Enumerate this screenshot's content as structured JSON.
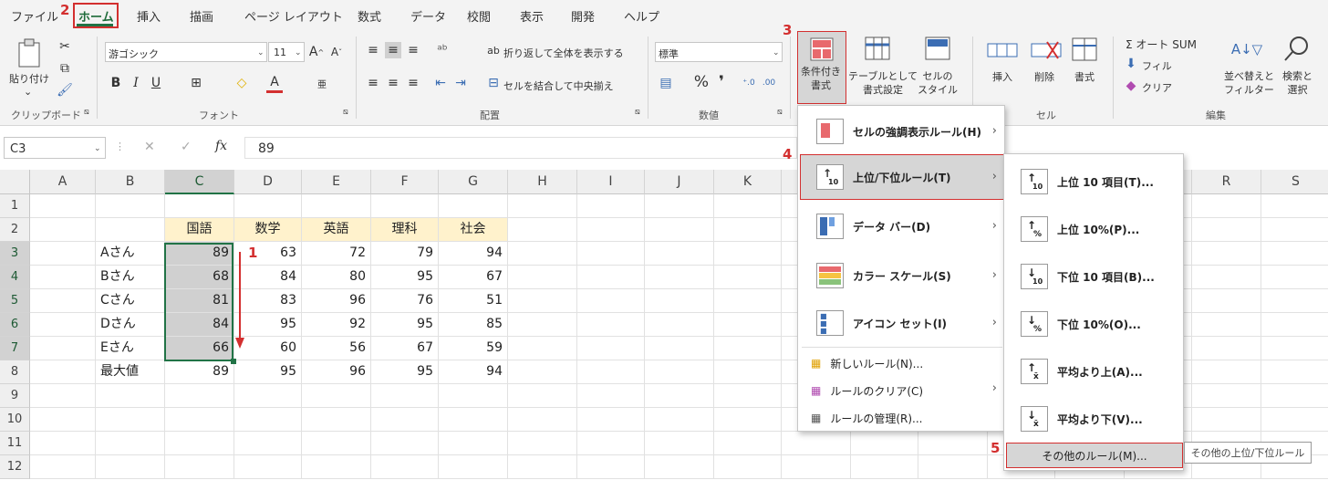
{
  "tabs": [
    "ファイル",
    "ホーム",
    "挿入",
    "描画",
    "ページ レイアウト",
    "数式",
    "データ",
    "校閲",
    "表示",
    "開発",
    "ヘルプ"
  ],
  "ribbon": {
    "clipboard": {
      "paste": "貼り付け",
      "group": "クリップボード"
    },
    "font": {
      "name": "游ゴシック",
      "size": "11",
      "group": "フォント"
    },
    "alignment": {
      "wrap": "折り返して全体を表示する",
      "merge": "セルを結合して中央揃え",
      "group": "配置"
    },
    "number": {
      "format": "標準",
      "group": "数値"
    },
    "styles": {
      "cond_format": "条件付き\n書式",
      "table_format": "テーブルとして\n書式設定",
      "cell_style": "セルの\nスタイル"
    },
    "cells": {
      "insert": "挿入",
      "delete": "削除",
      "format": "書式",
      "group": "セル"
    },
    "editing": {
      "autosum": "Σ オート SUM",
      "fill": "フィル",
      "clear": "クリア",
      "sort": "並べ替えと\nフィルター",
      "find": "検索と\n選択",
      "group": "編集"
    }
  },
  "formula_bar": {
    "name_box": "C3",
    "fx": "fx",
    "value": "89"
  },
  "columns": [
    "A",
    "B",
    "C",
    "D",
    "E",
    "F",
    "G",
    "H",
    "I",
    "J",
    "K",
    "L",
    "M",
    "N",
    "O",
    "P",
    "Q",
    "R",
    "S"
  ],
  "rows": [
    "1",
    "2",
    "3",
    "4",
    "5",
    "6",
    "7",
    "8",
    "9",
    "10",
    "11",
    "12"
  ],
  "table": {
    "headers": [
      "国語",
      "数学",
      "英語",
      "理科",
      "社会"
    ],
    "names": [
      "Aさん",
      "Bさん",
      "Cさん",
      "Dさん",
      "Eさん",
      "最大値"
    ],
    "values": [
      [
        89,
        63,
        72,
        79,
        94
      ],
      [
        68,
        84,
        80,
        95,
        67
      ],
      [
        81,
        83,
        96,
        76,
        51
      ],
      [
        84,
        95,
        92,
        95,
        85
      ],
      [
        66,
        60,
        56,
        67,
        59
      ],
      [
        89,
        95,
        96,
        95,
        94
      ]
    ]
  },
  "cf_menu": [
    "セルの強調表示ルール(H)",
    "上位/下位ルール(T)",
    "データ バー(D)",
    "カラー スケール(S)",
    "アイコン セット(I)",
    "新しいルール(N)...",
    "ルールのクリア(C)",
    "ルールの管理(R)..."
  ],
  "submenu": [
    "上位 10 項目(T)...",
    "上位 10%(P)...",
    "下位 10 項目(B)...",
    "下位 10%(O)...",
    "平均より上(A)...",
    "平均より下(V)...",
    "その他のルール(M)..."
  ],
  "tooltip": "その他の上位/下位ルール",
  "steps": [
    "1",
    "2",
    "3",
    "4",
    "5"
  ],
  "colors": {
    "accent_red": "#d32f2f",
    "header_fill": "#fff2cc",
    "selection": "#d0d0d0",
    "excel_green": "#217346"
  }
}
